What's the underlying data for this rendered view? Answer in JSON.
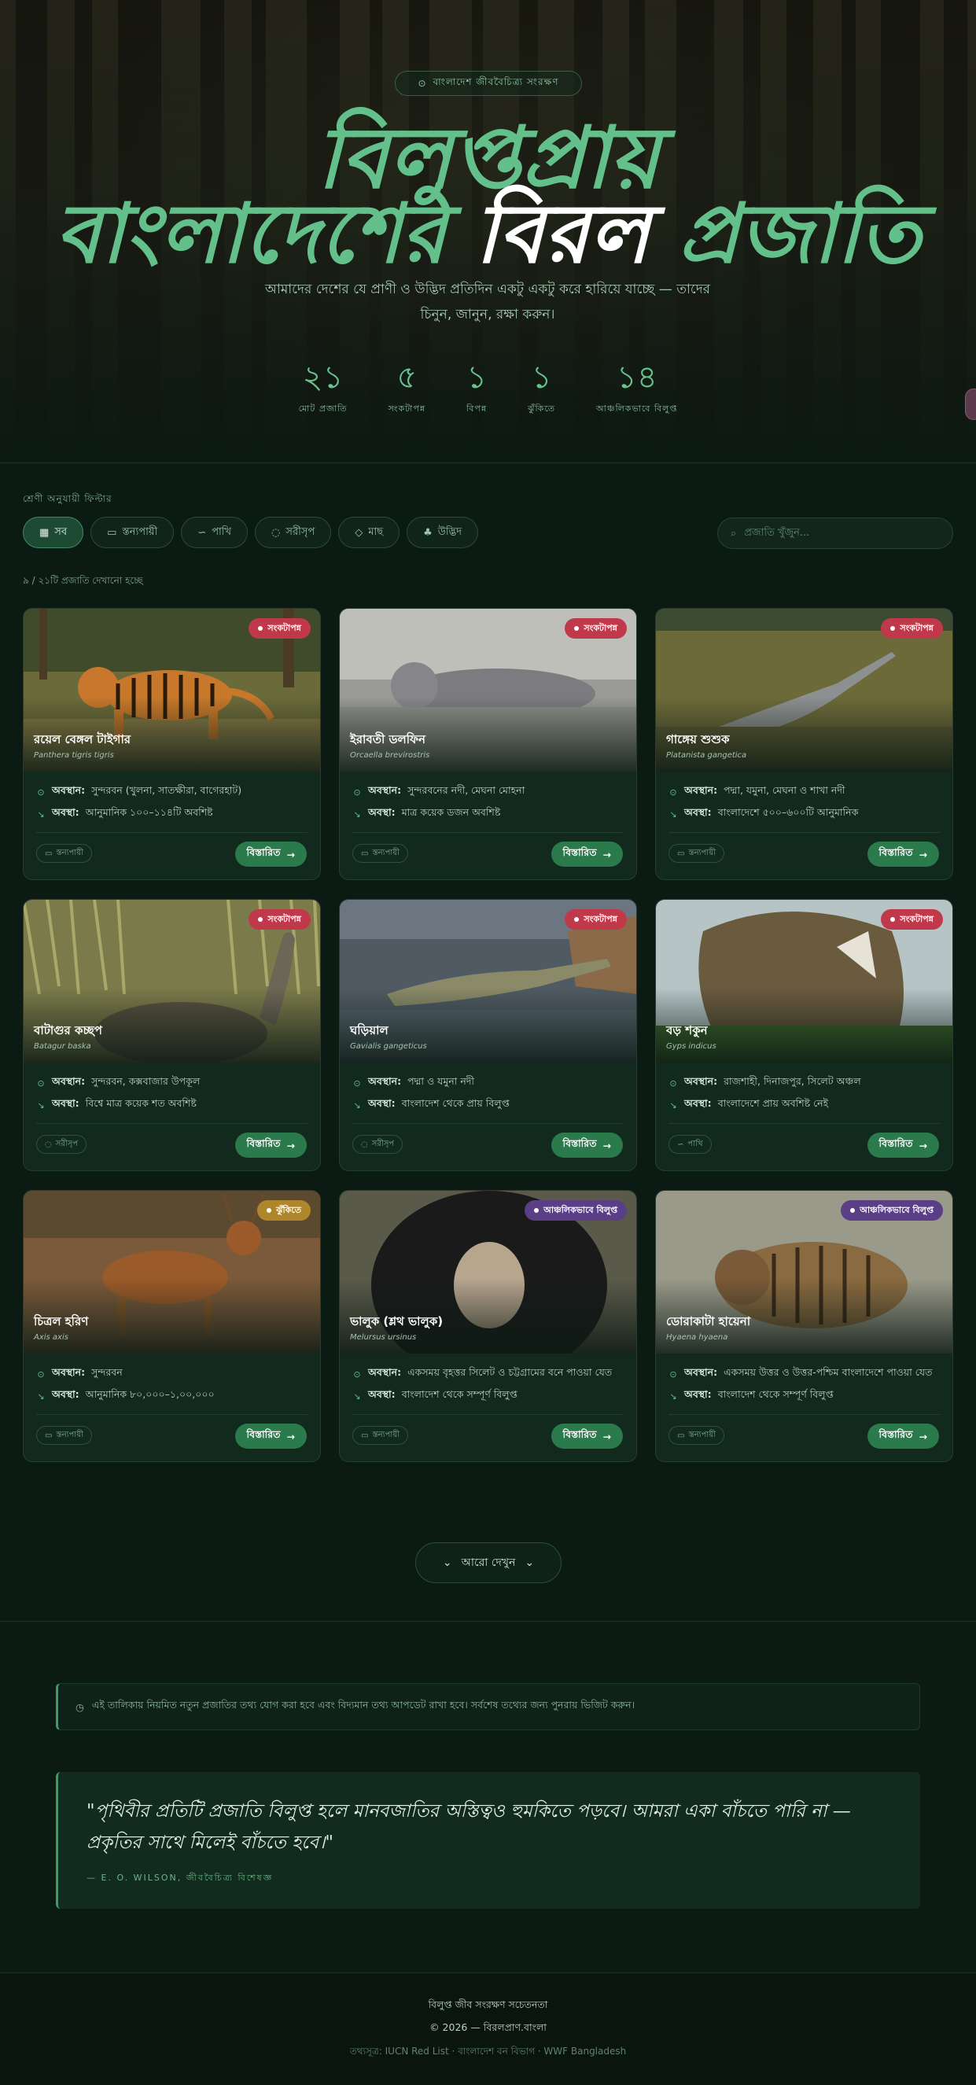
{
  "hero": {
    "badge": "বাংলাদেশ জীববৈচিত্র্য সংরক্ষণ",
    "title_line1": "বিলুপ্তপ্রায়",
    "title_part1": "বাংলাদেশের ",
    "title_part2": "বিরল",
    "title_part3": " প্রজাতি",
    "subtitle": "আমাদের দেশের যে প্রাণী ও উদ্ভিদ প্রতিদিন একটু একটু করে হারিয়ে যাচ্ছে — তাদের চিনুন, জানুন, রক্ষা করুন।",
    "stats": [
      {
        "value": "২১",
        "label": "মোট প্রজাতি"
      },
      {
        "value": "৫",
        "label": "সংকটাপন্ন"
      },
      {
        "value": "১",
        "label": "বিপন্ন"
      },
      {
        "value": "১",
        "label": "ঝুঁকিতে"
      },
      {
        "value": "১৪",
        "label": "আঞ্চলিকভাবে বিলুপ্ত"
      }
    ]
  },
  "filters": {
    "label": "শ্রেণী অনুযায়ী ফিল্টার",
    "items": [
      {
        "icon": "▦",
        "label": "সব"
      },
      {
        "icon": "▭",
        "label": "স্তন্যপায়ী"
      },
      {
        "icon": "∽",
        "label": "পাখি"
      },
      {
        "icon": "◌",
        "label": "সরীসৃপ"
      },
      {
        "icon": "◇",
        "label": "মাছ"
      },
      {
        "icon": "♣",
        "label": "উদ্ভিদ"
      }
    ],
    "search_placeholder": "প্রজাতি খুঁজুন...",
    "showing": "৯ / ২১টি প্রজাতি দেখানো হচ্ছে"
  },
  "labels": {
    "location": "অবস্থান:",
    "status": "অবস্থা:",
    "details": "বিস্তারিত"
  },
  "cards": [
    {
      "name": "রয়েল বেঙ্গল টাইগার",
      "sci": "Panthera tigris tigris",
      "badge": "সংকটাপন্ন",
      "location": "সুন্দরবন (খুলনা, সাতক্ষীরা, বাগেরহাট)",
      "status": "আনুমানিক ১০০–১১৪টি অবশিষ্ট",
      "tag": "স্তন্যপায়ী"
    },
    {
      "name": "ইরাবতী ডলফিন",
      "sci": "Orcaella brevirostris",
      "badge": "সংকটাপন্ন",
      "location": "সুন্দরবনের নদী, মেঘনা মোহনা",
      "status": "মাত্র কয়েক ডজন অবশিষ্ট",
      "tag": "স্তন্যপায়ী"
    },
    {
      "name": "গাঙ্গেয় শুশুক",
      "sci": "Platanista gangetica",
      "badge": "সংকটাপন্ন",
      "location": "পদ্মা, যমুনা, মেঘনা ও শাখা নদী",
      "status": "বাংলাদেশে ৫০০–৬০০টি আনুমানিক",
      "tag": "স্তন্যপায়ী"
    },
    {
      "name": "বাটাগুর কচ্ছপ",
      "sci": "Batagur baska",
      "badge": "সংকটাপন্ন",
      "location": "সুন্দরবন, কক্সবাজার উপকূল",
      "status": "বিশ্বে মাত্র কয়েক শত অবশিষ্ট",
      "tag": "সরীসৃপ"
    },
    {
      "name": "ঘড়িয়াল",
      "sci": "Gavialis gangeticus",
      "badge": "সংকটাপন্ন",
      "location": "পদ্মা ও যমুনা নদী",
      "status": "বাংলাদেশ থেকে প্রায় বিলুপ্ত",
      "tag": "সরীসৃপ"
    },
    {
      "name": "বড় শকুন",
      "sci": "Gyps indicus",
      "badge": "সংকটাপন্ন",
      "location": "রাজশাহী, দিনাজপুর, সিলেট অঞ্চল",
      "status": "বাংলাদেশে প্রায় অবশিষ্ট নেই",
      "tag": "পাখি"
    },
    {
      "name": "চিত্রল হরিণ",
      "sci": "Axis axis",
      "badge": "ঝুঁকিতে",
      "location": "সুন্দরবন",
      "status": "আনুমানিক ৮০,০০০–১,০০,০০০",
      "tag": "স্তন্যপায়ী"
    },
    {
      "name": "ভালুক (শ্লথ ভালুক)",
      "sci": "Melursus ursinus",
      "badge": "আঞ্চলিকভাবে বিলুপ্ত",
      "location": "একসময় বৃহত্তর সিলেট ও চট্টগ্রামের বনে পাওয়া যেত",
      "status": "বাংলাদেশ থেকে সম্পূর্ণ বিলুপ্ত",
      "tag": "স্তন্যপায়ী"
    },
    {
      "name": "ডোরাকাটা হায়েনা",
      "sci": "Hyaena hyaena",
      "badge": "আঞ্চলিকভাবে বিলুপ্ত",
      "location": "একসময় উত্তর ও উত্তর-পশ্চিম বাংলাদেশে পাওয়া যেত",
      "status": "বাংলাদেশ থেকে সম্পূর্ণ বিলুপ্ত",
      "tag": "স্তন্যপায়ী"
    }
  ],
  "more_button": "আরো দেখুন",
  "notice": "এই তালিকায় নিয়মিত নতুন প্রজাতির তথ্য যোগ করা হবে এবং বিদ্যমান তথ্য আপডেট রাখা হবে। সর্বশেষ তথ্যের জন্য পুনরায় ভিজিট করুন।",
  "quote": {
    "text": "\"পৃথিবীর প্রতিটি প্রজাতি বিলুপ্ত হলে মানবজাতির অস্তিত্বও হুমকিতে পড়বে। আমরা একা বাঁচতে পারি না — প্রকৃতির সাথে মিলেই বাঁচতে হবে।\"",
    "author": "— E. O. WILSON, জীববৈচিত্র্য বিশেষজ্ঞ"
  },
  "footer": {
    "line1": "বিলুপ্ত জীব সংরক্ষণ সচেতনতা",
    "line2": "© 2026 — বিরলপ্রাণ.বাংলা",
    "line3": "তথ্যসূত্র: IUCN Red List · বাংলাদেশ বন বিভাগ · WWF Bangladesh"
  },
  "colors": {
    "accent": "#63c08a",
    "critical": "#c0394b",
    "vulnerable": "#b0862c",
    "extinct_regional": "#5b3f86"
  }
}
